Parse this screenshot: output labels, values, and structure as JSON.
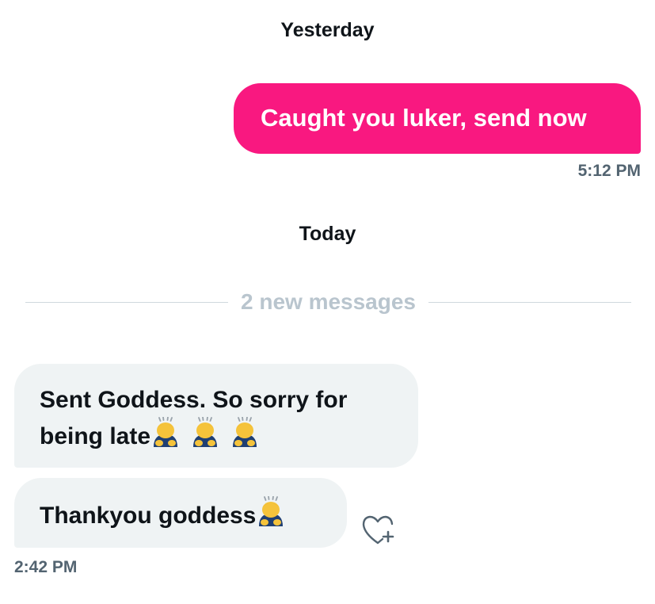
{
  "conversation": {
    "day_yesterday": "Yesterday",
    "day_today": "Today",
    "new_messages_label": "2 new messages",
    "messages": [
      {
        "direction": "sent",
        "text": "Caught you luker, send now",
        "time": "5:12 PM"
      },
      {
        "direction": "received",
        "text_line1": "Sent Goddess. So sorry for",
        "text_line2": "being late",
        "emoji": "person-bowing",
        "emoji_count": 3
      },
      {
        "direction": "received",
        "text": "Thankyou goddess",
        "emoji": "person-bowing",
        "emoji_count": 1,
        "time": "2:42 PM"
      }
    ]
  },
  "icons": {
    "react": "heart-plus-icon",
    "emoji": "person-bowing-emoji"
  },
  "colors": {
    "sent_bubble": "#f91880",
    "received_bubble": "#eff3f4",
    "timestamp": "#536471",
    "new_messages": "#b9c5ce",
    "divider": "#cfd9de"
  }
}
